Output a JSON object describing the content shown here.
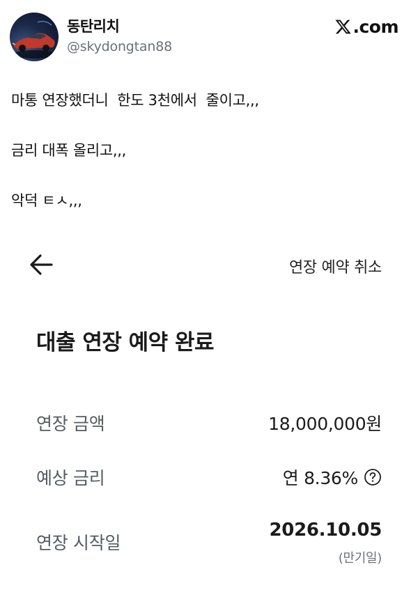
{
  "tweet": {
    "author": {
      "display_name": "동탄리치",
      "handle": "@skydongtan88"
    },
    "brand": ".com",
    "lines": [
      "마통 연장했더니  한도 3천에서  줄이고,,,",
      "금리 대폭 올리고,,,",
      "악덕 ㅌㅅ,,,"
    ]
  },
  "app": {
    "top_action": "연장 예약 취소",
    "title": "대출 연장 예약 완료",
    "rows": [
      {
        "label": "연장 금액",
        "value": "18,000,000원"
      },
      {
        "label": "예상 금리",
        "value": "연 8.36%"
      },
      {
        "label": "연장 시작일",
        "value": "2026.10.05",
        "sub": "(만기일)"
      }
    ]
  },
  "icons": {
    "back": "arrow-left-icon",
    "help": "question-circle-icon",
    "brand": "x-logo-icon"
  }
}
